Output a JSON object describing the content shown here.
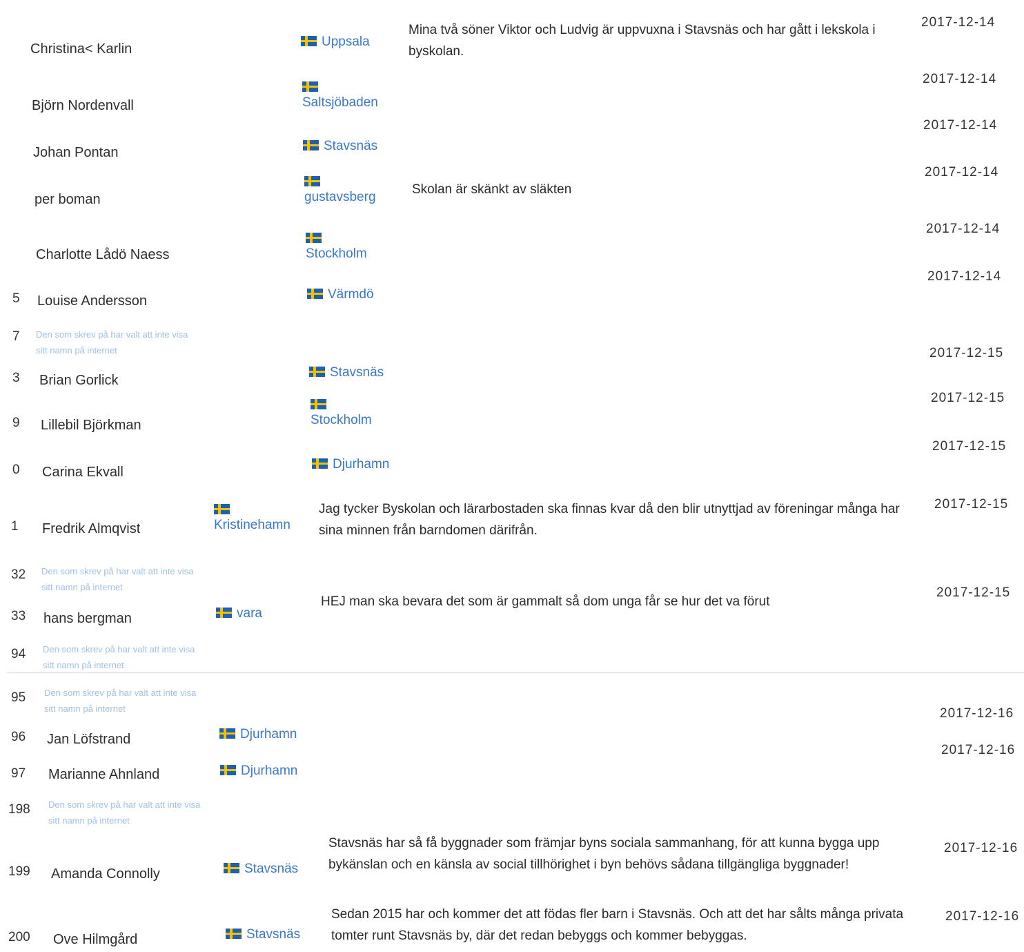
{
  "colors": {
    "link": "#3a78c9",
    "anon_text": "#9fc1e6",
    "flag_blue": "#1e5fb0",
    "flag_yellow": "#f2c200"
  },
  "flag_icon": "swedish-flag-icon",
  "entries": [
    {
      "num": "",
      "name": "Christina< Karlin",
      "location": "Uppsala",
      "comment": "Mina två söner Viktor och Ludvig är uppvuxna i Stavsnäs och har gått i lekskola i byskolan.",
      "date": "2017-12-14"
    },
    {
      "num": "",
      "name": "Björn Nordenvall",
      "location": "Saltsjöbaden",
      "comment": "",
      "date": "2017-12-14"
    },
    {
      "num": "",
      "name": "Johan Pontan",
      "location": "Stavsnäs",
      "comment": "",
      "date": "2017-12-14"
    },
    {
      "num": "",
      "name": "per boman",
      "location": "gustavsberg",
      "comment": "Skolan är skänkt av släkten",
      "date": "2017-12-14"
    },
    {
      "num": "",
      "name": "Charlotte Lådö Naess",
      "location": "Stockholm",
      "comment": "",
      "date": "2017-12-14"
    },
    {
      "num": "5",
      "name": "Louise Andersson",
      "location": "Värmdö",
      "comment": "",
      "date": "2017-12-14"
    },
    {
      "num": "7",
      "anon": "Den som skrev på har valt att inte visa sitt namn på internet"
    },
    {
      "num": "3",
      "name": "Brian Gorlick",
      "location": "Stavsnäs",
      "comment": "",
      "date": "2017-12-15"
    },
    {
      "num": "9",
      "name": "Lillebil Björkman",
      "location": "Stockholm",
      "comment": "",
      "date": "2017-12-15"
    },
    {
      "num": "0",
      "name": "Carina Ekvall",
      "location": "Djurhamn",
      "comment": "",
      "date": "2017-12-15"
    },
    {
      "num": "1",
      "name": "Fredrik Almqvist",
      "location": "Kristinehamn",
      "comment": "Jag tycker Byskolan och lärarbostaden ska finnas kvar då den blir utnyttjad av föreningar många har sina minnen från barndomen därifrån.",
      "date": "2017-12-15"
    },
    {
      "num": "32",
      "anon": "Den som skrev på har valt att inte visa sitt namn på internet"
    },
    {
      "num": "33",
      "name": "hans bergman",
      "location": "vara",
      "comment": "HEJ man ska bevara det som är gammalt så dom unga får se hur det va förut",
      "date": "2017-12-15"
    },
    {
      "num": "94",
      "anon": "Den som skrev på har valt att inte visa sitt namn på internet"
    },
    {
      "num": "95",
      "anon": "Den som skrev på har valt att inte visa sitt namn på internet"
    },
    {
      "num": "96",
      "name": "Jan Löfstrand",
      "location": "Djurhamn",
      "comment": "",
      "date": "2017-12-16"
    },
    {
      "num": "97",
      "name": "Marianne Ahnland",
      "location": "Djurhamn",
      "comment": "",
      "date": "2017-12-16"
    },
    {
      "num": "198",
      "anon": "Den som skrev på har valt att inte visa sitt namn på internet"
    },
    {
      "num": "199",
      "name": "Amanda Connolly",
      "location": "Stavsnäs",
      "comment": "Stavsnäs har så få byggnader som främjar byns sociala sammanhang, för att kunna bygga upp bykänslan och en känsla av social tillhörighet i byn behövs sådana tillgängliga byggnader!",
      "date": "2017-12-16"
    },
    {
      "num": "200",
      "name": "Ove Hilmgård",
      "location": "Stavsnäs",
      "comment": "Sedan 2015 har och kommer det att födas fler barn i Stavsnäs. Och att det har sålts många privata tomter runt Stavsnäs by, där det redan bebyggs och kommer bebyggas.",
      "date": "2017-12-16"
    }
  ]
}
